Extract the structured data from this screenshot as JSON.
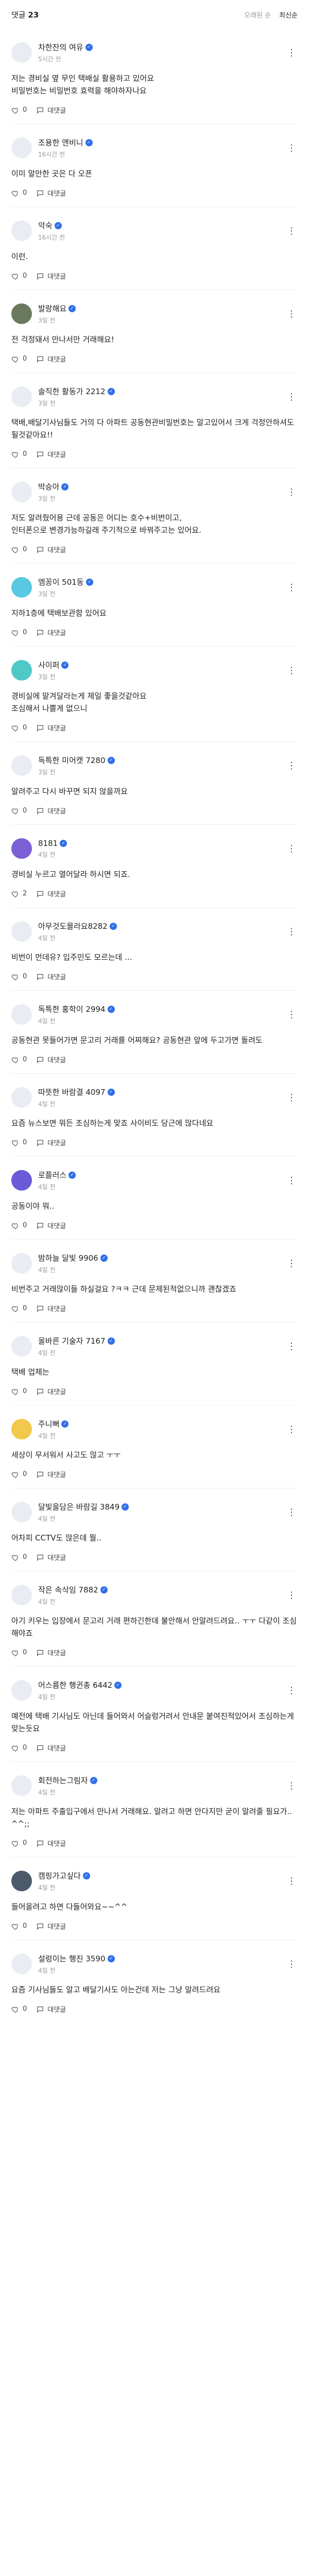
{
  "header": {
    "title": "댓글",
    "count": "23",
    "sort_old": "오래된 순",
    "sort_new": "최신순"
  },
  "comments": [
    {
      "nick": "차한잔의 여유",
      "time": "5시간 전",
      "text": "저는 경비실 옆 무인 택배실 활용하고 있어요\n비밀번호는 비밀번호 효력을 해야하자나요",
      "likes": "0",
      "reply": "대댓글",
      "avatar_bg": "#e9ecf2",
      "avatar_text": ""
    },
    {
      "nick": "조용한 앤비니",
      "time": "16시간 전",
      "text": "이미 알만한 곳은 다 오픈",
      "likes": "0",
      "reply": "대댓글",
      "avatar_bg": "#e9ecf2",
      "avatar_text": ""
    },
    {
      "nick": "악숙",
      "time": "16시간 전",
      "text": "이런.",
      "likes": "0",
      "reply": "대댓글",
      "avatar_bg": "#e9ecf2",
      "avatar_text": ""
    },
    {
      "nick": "발랑해요",
      "time": "3일 전",
      "text": "전 걱정돼서 만나서만 거래해요!",
      "likes": "0",
      "reply": "대댓글",
      "avatar_bg": "#6b7a5e",
      "avatar_text": ""
    },
    {
      "nick": "솔직한 활동가 2212",
      "time": "3일 전",
      "text": "택배,배달기사님들도 거의 다 아파트 공동현관비밀번호는 알고있어서 크게 걱정안하셔도될것같아요!!",
      "likes": "0",
      "reply": "대댓글",
      "avatar_bg": "#e9ecf2",
      "avatar_text": ""
    },
    {
      "nick": "박승아",
      "time": "3일 전",
      "text": "저도 알려줬어용 근데 공동은 어디는 호수+비번이고,\n인터폰으로 변경가능하길래 주기적으로 바꿔주고는 있어요.",
      "likes": "0",
      "reply": "대댓글",
      "avatar_bg": "#e9ecf2",
      "avatar_text": ""
    },
    {
      "nick": "엠꽁이 501동",
      "time": "3일 전",
      "text": "지하1층에 택배보관함 있어요",
      "likes": "0",
      "reply": "대댓글",
      "avatar_bg": "#58c9e0",
      "avatar_text": ""
    },
    {
      "nick": "사이퍼",
      "time": "3일 전",
      "text": "경비실에 맡겨달라는게 제일 좋을것같아요\n조심해서 나쁠게 없으니",
      "likes": "0",
      "reply": "대댓글",
      "avatar_bg": "#4fc9c7",
      "avatar_text": ""
    },
    {
      "nick": "독특한 미어캣 7280",
      "time": "3일 전",
      "text": "알려주고 다시 바꾸면 되지 않을까요",
      "likes": "0",
      "reply": "대댓글",
      "avatar_bg": "#e9ecf2",
      "avatar_text": ""
    },
    {
      "nick": "8181",
      "time": "4일 전",
      "text": "경비실 누르고 열어달라 하시면 되죠.",
      "likes": "2",
      "reply": "대댓글",
      "avatar_bg": "#7b5fd6",
      "avatar_text": ""
    },
    {
      "nick": "아무것도몰라요8282",
      "time": "4일 전",
      "text": "비번이 먼데유? 입주민도 모르는데 ...",
      "likes": "0",
      "reply": "대댓글",
      "avatar_bg": "#e9ecf2",
      "avatar_text": ""
    },
    {
      "nick": "독특한 홍학이 2994",
      "time": "4일 전",
      "text": "공동현관 못들어가면 문고리 거래를 어찌해요? 공동현관 앞에 두고가면 돌려도",
      "likes": "0",
      "reply": "대댓글",
      "avatar_bg": "#e9ecf2",
      "avatar_text": ""
    },
    {
      "nick": "따뜻한 바람결 4097",
      "time": "4일 전",
      "text": "요즘 뉴스보면 뭐든 조심하는게 맞죠 사이비도 당근에 많다네요",
      "likes": "0",
      "reply": "대댓글",
      "avatar_bg": "#e9ecf2",
      "avatar_text": ""
    },
    {
      "nick": "로플러스",
      "time": "4일 전",
      "text": "공동이야 뭐..",
      "likes": "0",
      "reply": "대댓글",
      "avatar_bg": "#6a5ad8",
      "avatar_text": ""
    },
    {
      "nick": "밤하늘 달빛 9906",
      "time": "4일 전",
      "text": "비번주고 거래많이들 하실걸요 ?ㅋㅋ 근데 문제된적없으니까 괜찮겠죠",
      "likes": "0",
      "reply": "대댓글",
      "avatar_bg": "#e9ecf2",
      "avatar_text": ""
    },
    {
      "nick": "올바른 기술자 7167",
      "time": "4일 전",
      "text": "택배 업체는",
      "likes": "0",
      "reply": "대댓글",
      "avatar_bg": "#e9ecf2",
      "avatar_text": ""
    },
    {
      "nick": "주니뻐",
      "time": "4일 전",
      "text": "세상이 무서워서 사고도 많고 ㅜㅜ",
      "likes": "0",
      "reply": "대댓글",
      "avatar_bg": "#f2c94c",
      "avatar_text": ""
    },
    {
      "nick": "달빛을담은 바람길 3849",
      "time": "4일 전",
      "text": "어차피 CCTV도 많은데 뭘..",
      "likes": "0",
      "reply": "대댓글",
      "avatar_bg": "#e9ecf2",
      "avatar_text": ""
    },
    {
      "nick": "작은 속삭임 7882",
      "time": "4일 전",
      "text": "아기 키우는 입장에서 문고리 거래 편하긴한데 불안해서 안알려드려요.. ㅜㅜ 다같이 조심해야죠",
      "likes": "0",
      "reply": "대댓글",
      "avatar_bg": "#e9ecf2",
      "avatar_text": ""
    },
    {
      "nick": "어스름한 행귄총 6442",
      "time": "4일 전",
      "text": "예전에 택배 기사님도 아닌데 들어와서 어슬렁거려서 안내문 붙여진적있어서 조심하는게 맞는듯요",
      "likes": "0",
      "reply": "대댓글",
      "avatar_bg": "#e9ecf2",
      "avatar_text": ""
    },
    {
      "nick": "회전하는그림자",
      "time": "4일 전",
      "text": "저는 아파트 주출입구에서 만나서 거래해요. 알려고 하면 안다지만 굳이 알려줄 필요가.. ^^;;",
      "likes": "0",
      "reply": "대댓글",
      "avatar_bg": "#e9ecf2",
      "avatar_text": ""
    },
    {
      "nick": "캠핑가고싶다",
      "time": "4일 전",
      "text": "들어올려고 하면 다들어와요~~^^",
      "likes": "0",
      "reply": "대댓글",
      "avatar_bg": "#4a5a6a",
      "avatar_text": ""
    },
    {
      "nick": "설렁이는 행진 3590",
      "time": "4일 전",
      "text": "요즘 기사님들도 알고 배달기사도 아는건데 저는 그냥 알려드려요",
      "likes": "0",
      "reply": "대댓글",
      "avatar_bg": "#e9ecf2",
      "avatar_text": ""
    }
  ]
}
